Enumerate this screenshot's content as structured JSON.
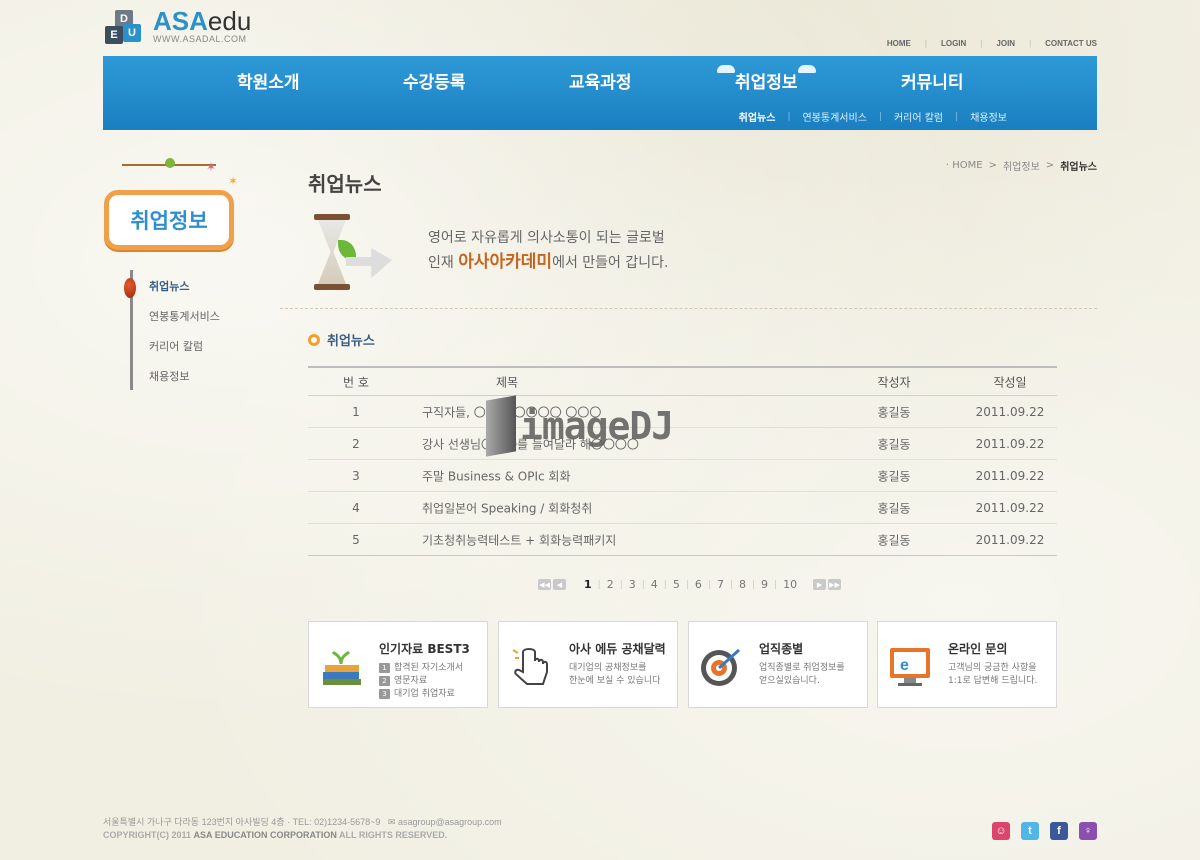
{
  "logo": {
    "cube1": "D",
    "cube2": "E",
    "cube3": "U",
    "asa": "ASA",
    "edu": "edu",
    "url": "WWW.ASADAL.COM"
  },
  "util_nav": [
    "HOME",
    "LOGIN",
    "JOIN",
    "CONTACT US"
  ],
  "gnb": {
    "items": [
      "학원소개",
      "수강등록",
      "교육과정",
      "취업정보",
      "커뮤니티"
    ],
    "active": "취업정보",
    "sub": [
      "취업뉴스",
      "연봉통계서비스",
      "커리어 칼럼",
      "채용정보"
    ]
  },
  "lnb": {
    "title": "취업정보",
    "items": [
      "취업뉴스",
      "연봉통계서비스",
      "커리어 칼럼",
      "채용정보"
    ]
  },
  "breadcrumb": [
    "· HOME",
    "취업정보",
    "취업뉴스"
  ],
  "page_title": "취업뉴스",
  "hero": {
    "line1": "영어로 자유롭게 의사소통이 되는 글로벌",
    "line2_pre": "인재 ",
    "line2_highlight": "아사아카데미",
    "line2_post": "에서 만들어 갑니다."
  },
  "section_title": "취업뉴스",
  "board": {
    "headers": {
      "no": "번 호",
      "title": "제목",
      "writer": "작성자",
      "date": "작성일"
    },
    "rows": [
      {
        "no": "1",
        "title": "구직자들, 〇〇〇 〇〇〇〇 〇〇〇",
        "writer": "홍길동",
        "date": "2011.09.22"
      },
      {
        "no": "2",
        "title": "강사 선생님〇〇〇를 들여달라 해〇〇〇〇",
        "writer": "홍길동",
        "date": "2011.09.22"
      },
      {
        "no": "3",
        "title": "주말 Business & OPIc 회화",
        "writer": "홍길동",
        "date": "2011.09.22"
      },
      {
        "no": "4",
        "title": "취업일본어 Speaking / 회화청취",
        "writer": "홍길동",
        "date": "2011.09.22"
      },
      {
        "no": "5",
        "title": "기초청취능력테스트 + 회화능력패키지",
        "writer": "홍길동",
        "date": "2011.09.22"
      }
    ]
  },
  "watermark": "imageDJ",
  "paging": {
    "current": "1",
    "pages": [
      "1",
      "2",
      "3",
      "4",
      "5",
      "6",
      "7",
      "8",
      "9",
      "10"
    ]
  },
  "banners": [
    {
      "title": "인기자료 BEST3",
      "lines": [
        "합격된 자기소개서",
        "영문자료",
        "대기업 취업자료"
      ]
    },
    {
      "title": "아사 에듀 공채달력",
      "lines": [
        "대기업의 공채정보를",
        "한눈에 보실 수 있습니다"
      ]
    },
    {
      "title": "업직종별",
      "lines": [
        "업직종별로 취업정보를",
        "얻으실있습니다."
      ]
    },
    {
      "title": "온라인 문의",
      "lines": [
        "고객님의 궁금한 사항을",
        "1:1로 답변해 드립니다."
      ]
    }
  ],
  "footer": {
    "address": "서울특별시 가나구 다라동 123번지 아사빌딩 4층 · TEL: 02)1234-5678~9",
    "email": "asagroup@asagroup.com",
    "copyright_pre": "COPYRIGHT(C) 2011 ",
    "copyright_bold": "ASA EDUCATION CORPORATION",
    "copyright_post": " ALL RIGHTS RESERVED."
  },
  "colors": {
    "nav_blue": "#2a91c9",
    "highlight_orange": "#c8631d",
    "accent_orange": "#f0a030"
  }
}
